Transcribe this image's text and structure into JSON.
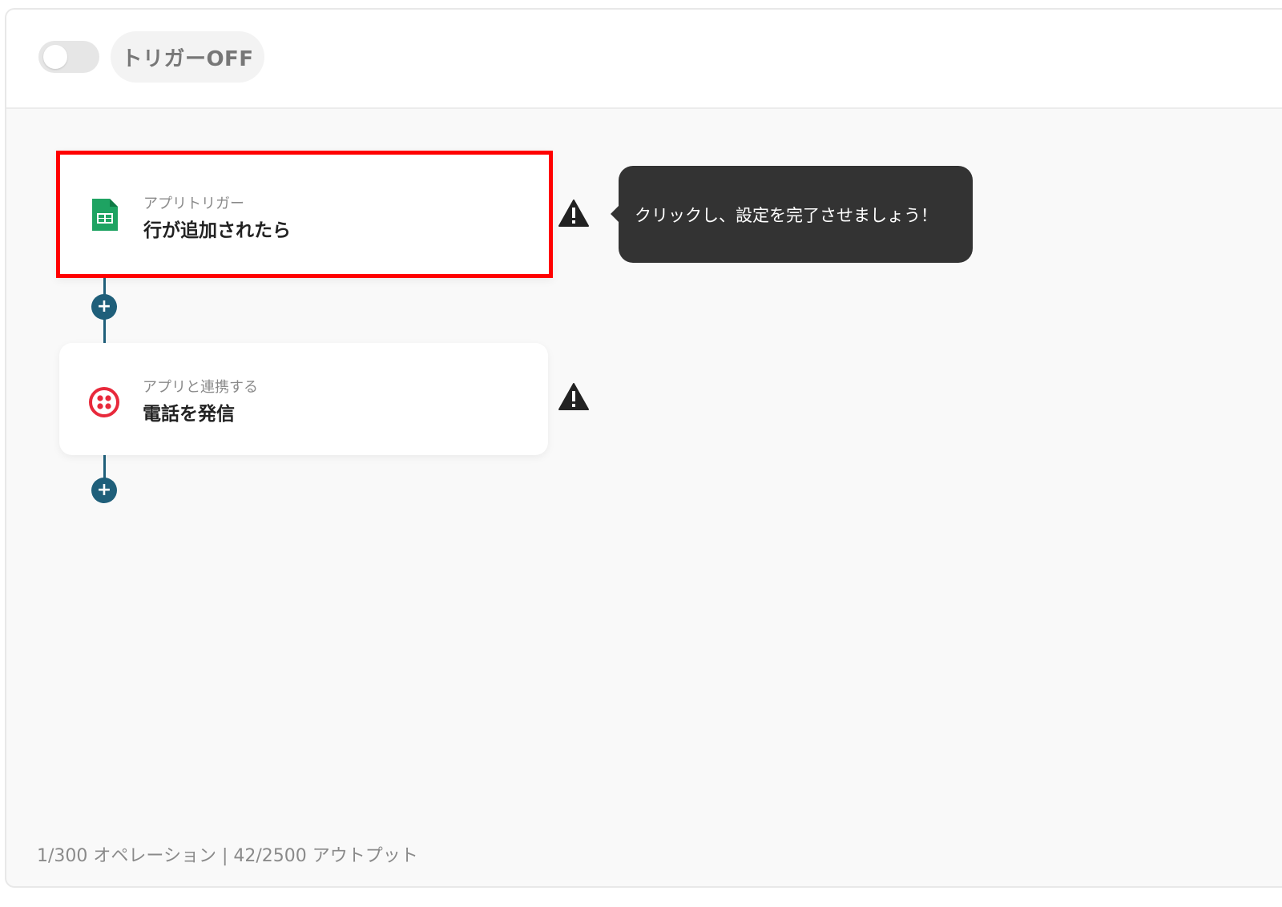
{
  "header": {
    "trigger_toggle_label": "トリガーOFF",
    "trigger_enabled": false
  },
  "steps": [
    {
      "subtitle": "アプリトリガー",
      "title": "行が追加されたら",
      "icon": "google-sheets-icon",
      "warning": true
    },
    {
      "subtitle": "アプリと連携する",
      "title": "電話を発信",
      "icon": "twilio-icon",
      "warning": true
    }
  ],
  "tooltip": {
    "text": "クリックし、設定を完了させましょう！"
  },
  "footer": {
    "usage": "1/300 オペレーション | 42/2500 アウトプット"
  },
  "colors": {
    "highlight_border": "#ff0000",
    "connector": "#1f5f7a",
    "tooltip_bg": "#333333",
    "sheets_green": "#1ea362",
    "twilio_red": "#e8293b"
  }
}
